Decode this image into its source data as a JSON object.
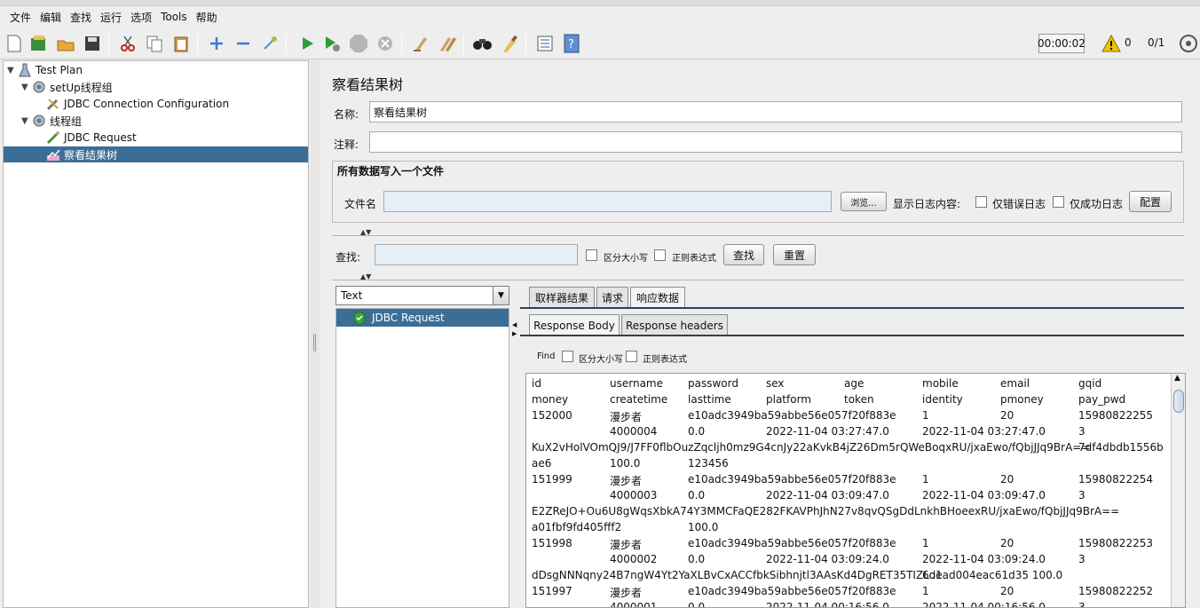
{
  "menu": [
    "文件",
    "编辑",
    "查找",
    "运行",
    "选项",
    "Tools",
    "帮助"
  ],
  "toolbar": {
    "timer": "00:00:02",
    "warnings": "0",
    "threads": "0/1"
  },
  "tree": {
    "items": [
      {
        "label": "Test Plan"
      },
      {
        "label": "setUp线程组"
      },
      {
        "label": "JDBC Connection Configuration"
      },
      {
        "label": "线程组"
      },
      {
        "label": "JDBC Request"
      },
      {
        "label": "察看结果树"
      }
    ]
  },
  "panel": {
    "title": "察看结果树",
    "name_label": "名称:",
    "name_value": "察看结果树",
    "comment_label": "注释:",
    "comment_value": "",
    "write_all_title": "所有数据写入一个文件",
    "filename_label": "文件名",
    "browse_button": "浏览...",
    "log_label": "显示日志内容:",
    "errors_only": "仅错误日志",
    "success_only": "仅成功日志",
    "config_button": "配置",
    "search_label": "查找:",
    "case_sensitive": "区分大小写",
    "regex": "正则表达式",
    "search_button": "查找",
    "reset_button": "重置"
  },
  "results": {
    "renderer": "Text",
    "items": [
      {
        "label": "JDBC Request",
        "status": "success"
      }
    ]
  },
  "tabs": {
    "main": [
      "取样器结果",
      "请求",
      "响应数据"
    ],
    "active_main": "响应数据",
    "sub": [
      "Response Body",
      "Response headers"
    ],
    "active_sub": "Response Body"
  },
  "find": {
    "label": "Find",
    "case_sensitive": "区分大小写",
    "regex": "正则表达式"
  },
  "response_lines": [
    [
      "id",
      "username",
      "password",
      "sex",
      "age",
      "mobile",
      "email",
      "gqid"
    ],
    [
      "money",
      "createtime",
      "lasttime",
      "platform",
      "token",
      "identity",
      "pmoney",
      "pay_pwd"
    ],
    [
      "152000",
      "漫步者",
      "e10adc3949ba59abbe56e057f20f883e",
      "",
      "",
      "1",
      "20",
      "15980822255"
    ],
    [
      "",
      "4000004",
      "0.0",
      "2022-11-04 03:27:47.0",
      "",
      "2022-11-04 03:27:47.0",
      "",
      "3"
    ],
    {
      "wide": "KuX2vHolVOmQJ9/J7FF0flbOuzZqcljh0mz9G4cnJy22aKvkB4jZ26Dm5rQWeBoqxRU/jxaEwo/fQbjJJq9BrA==",
      "tail": "7df4dbdb1556b"
    },
    [
      "ae6",
      "100.0",
      "123456"
    ],
    [
      "151999",
      "漫步者",
      "e10adc3949ba59abbe56e057f20f883e",
      "",
      "",
      "1",
      "20",
      "15980822254"
    ],
    [
      "",
      "4000003",
      "0.0",
      "2022-11-04 03:09:47.0",
      "",
      "2022-11-04 03:09:47.0",
      "",
      "3"
    ],
    {
      "wide": "E2ZReJO+Ou6U8gWqsXbkA74Y3MMCFaQE282FKAVPhJhN27v8qvQSgDdLnkhBHoeexRU/jxaEwo/fQbjJJq9BrA==",
      "tail": ""
    },
    [
      "a01fbf9fd405fff2",
      "",
      "100.0"
    ],
    [
      "151998",
      "漫步者",
      "e10adc3949ba59abbe56e057f20f883e",
      "",
      "",
      "1",
      "20",
      "15980822253"
    ],
    [
      "",
      "4000002",
      "0.0",
      "2022-11-04 03:09:24.0",
      "",
      "2022-11-04 03:09:24.0",
      "",
      "3"
    ],
    {
      "wide": "dDsgNNNqny24B7ngW4Yt2YaXLBvCxACCfbkSibhnjtl3AAsKd4DgRET35TIZLo1",
      "tail": "6dead004eac61d35          100.0"
    },
    [
      "151997",
      "漫步者",
      "e10adc3949ba59abbe56e057f20f883e",
      "",
      "",
      "1",
      "20",
      "15980822252"
    ],
    [
      "",
      "4000001",
      "0.0",
      "2022-11-04 00:16:56.0",
      "",
      "2022-11-04 00:16:56.0",
      "",
      "3"
    ]
  ],
  "colors": {
    "selection": "#3b6e96",
    "tab_line": "#2d3f63"
  }
}
